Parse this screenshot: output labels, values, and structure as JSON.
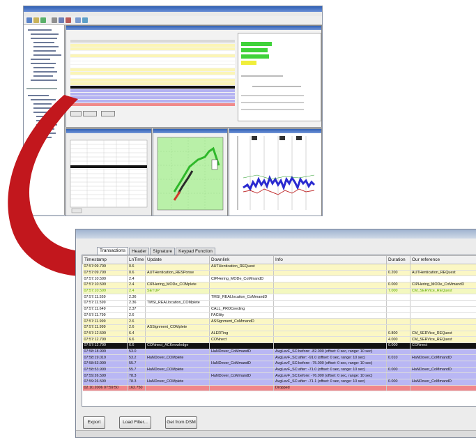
{
  "window": {
    "tabs": [
      "Transactions",
      "Header",
      "Signature",
      "Keypad Function"
    ],
    "active_tab": "Transactions"
  },
  "grid": {
    "columns": [
      "Timestamp",
      "LnTime",
      "Update",
      "Downlink",
      "Info",
      "Duration",
      "Our reference"
    ],
    "rows": [
      {
        "style": "y",
        "cells": [
          "07:57:09.799",
          "0.6",
          "",
          "AUTHentication_REQuest",
          "",
          "",
          ""
        ]
      },
      {
        "style": "y",
        "cells": [
          "07:57:09.799",
          "0.6",
          "AUTHentication_RESPonse",
          "",
          "",
          "0.200",
          "AUTHentication_REQuest"
        ]
      },
      {
        "style": "w",
        "cells": [
          "07:57:10.599",
          "2.4",
          "",
          "CIPHering_MODe_CoMmandD",
          "",
          "",
          ""
        ]
      },
      {
        "style": "y",
        "cells": [
          "07:57:10.599",
          "2.4",
          "CIPHering_MODe_COMplete",
          "",
          "",
          "0.000",
          "CIPHering_MODe_CoMmandD"
        ]
      },
      {
        "style": "g",
        "cells": [
          "07:57:10.599",
          "2.4",
          "SETUP",
          "",
          "",
          "7.000",
          "CM_SERVice_REQuest"
        ]
      },
      {
        "style": "w",
        "cells": [
          "07:57:11.559",
          "2.36",
          "",
          "TMSI_REALlocation_CoMmandD",
          "",
          "",
          ""
        ]
      },
      {
        "style": "w",
        "cells": [
          "07:57:11.599",
          "2.36",
          "TMSI_REALlocation_COMplete",
          "",
          "",
          "",
          ""
        ]
      },
      {
        "style": "w",
        "cells": [
          "07:57:11.649",
          "2.37",
          "",
          "CALL_PROCeeding",
          "",
          "",
          ""
        ]
      },
      {
        "style": "w",
        "cells": [
          "07:57:11.799",
          "2.6",
          "",
          "FACility",
          "",
          "",
          ""
        ]
      },
      {
        "style": "y",
        "cells": [
          "07:57:11.999",
          "2.6",
          "",
          "ASSignment_CoMmandD",
          "",
          "",
          ""
        ]
      },
      {
        "style": "y",
        "cells": [
          "07:57:11.999",
          "2.6",
          "ASSignment_COMplete",
          "",
          "",
          "",
          ""
        ]
      },
      {
        "style": "y",
        "cells": [
          "07:57:12.599",
          "6.4",
          "",
          "ALERTing",
          "",
          "0.800",
          "CM_SERVice_REQuest"
        ]
      },
      {
        "style": "y",
        "cells": [
          "07:57:12.799",
          "6.6",
          "",
          "CONnect",
          "",
          "4.000",
          "CM_SERVice_REQuest"
        ]
      },
      {
        "style": "k",
        "cells": [
          "07:57:12.799",
          "6.6",
          "CONnect_ACKnowledge",
          "",
          "",
          "0.000",
          "CONnect"
        ]
      },
      {
        "style": "p",
        "cells": [
          "07:58:18.999",
          "53.0",
          "",
          "HaNDover_CoMmandD",
          "AvgLevF_SC:before: -82.000 (offset: 0 sec, range: 10 sec)",
          "",
          ""
        ]
      },
      {
        "style": "p",
        "cells": [
          "07:58:19.019",
          "53.2",
          "HaNDover_COMplete",
          "",
          "AvgLevF_SC:after: -91.0 (offset: 0 sec, range: 10 sec)",
          "0.010",
          "HaNDover_CoMmandD"
        ]
      },
      {
        "style": "p",
        "cells": [
          "07:58:53.999",
          "55.7",
          "",
          "HaNDover_CoMmandD",
          "AvgLevF_SC:before: -75.000 (offset: 0 sec, range: 10 sec)",
          "",
          ""
        ]
      },
      {
        "style": "p",
        "cells": [
          "07:58:53.999",
          "55.7",
          "HaNDover_COMplete",
          "",
          "AvgLevF_SC:after: -71.0 (offset: 0 sec, range: 10 sec)",
          "0.000",
          "HaNDover_CoMmandD"
        ]
      },
      {
        "style": "p",
        "cells": [
          "07:59:26.599",
          "78.3",
          "",
          "HaNDover_CoMmandD",
          "AvgLevF_SC:before: -76.000 (offset: 0 sec, range: 10 sec)",
          "",
          ""
        ]
      },
      {
        "style": "p",
        "cells": [
          "07:59:26.599",
          "78.3",
          "HaNDover_COMplete",
          "",
          "AvgLevF_SC:after: -71.1 (offset: 0 sec, range: 10 sec)",
          "0.000",
          "HaNDover_CoMmandD"
        ]
      },
      {
        "style": "r",
        "cells": [
          "02.10.2006 07:59:50",
          "162.750",
          "",
          "",
          "Dropped",
          "",
          ""
        ]
      }
    ]
  },
  "buttons": {
    "export": "Export",
    "load_filter": "Load Filter...",
    "get_from_dsm": "Get from DSM"
  },
  "colors": {
    "row_yellow": "#fbf7c4",
    "row_purple": "#b9b7f4",
    "row_drop": "#f0868a",
    "arrow": "#c2171d"
  }
}
